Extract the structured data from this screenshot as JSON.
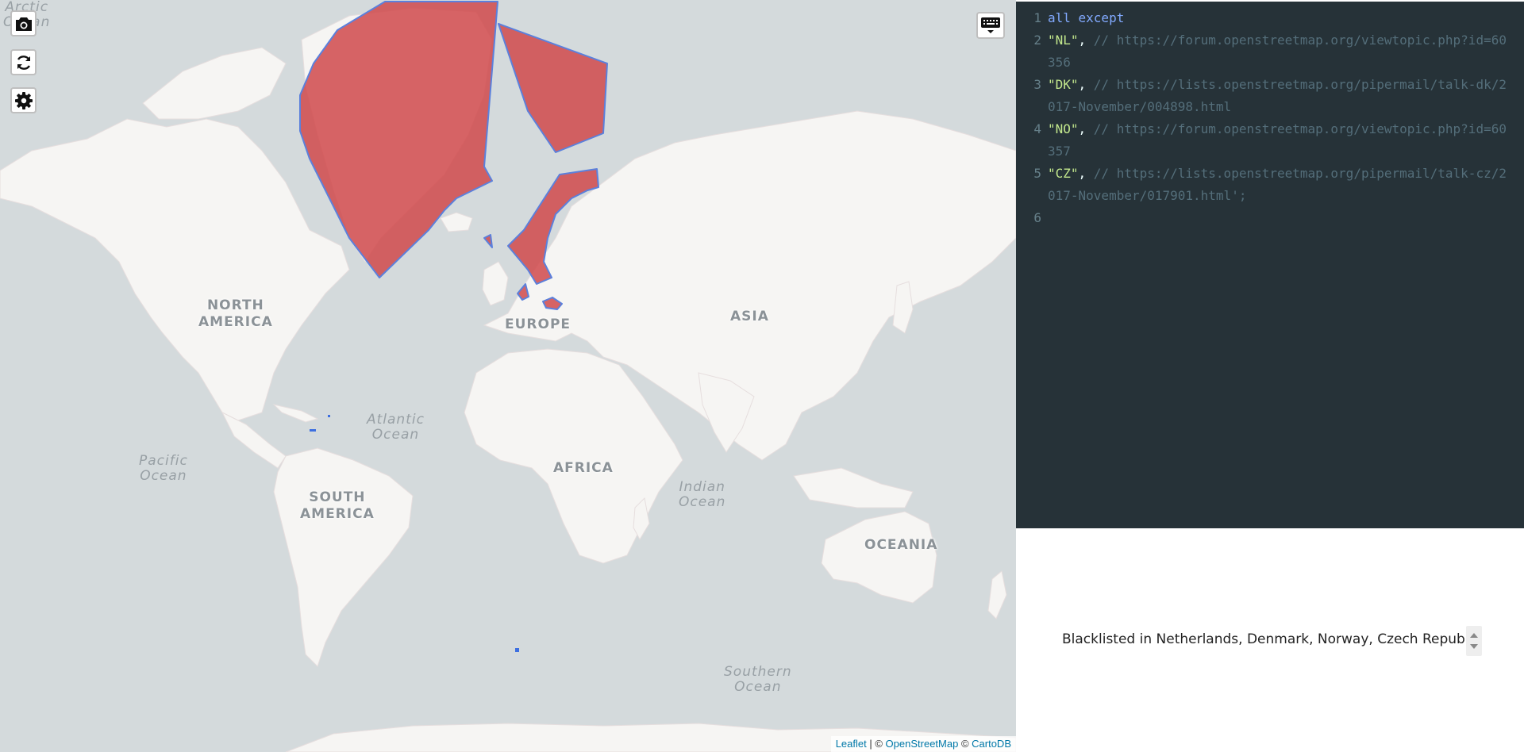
{
  "map": {
    "labels": {
      "north_america": "NORTH\nAMERICA",
      "south_america": "SOUTH\nAMERICA",
      "europe": "EUROPE",
      "asia": "ASIA",
      "africa": "AFRICA",
      "oceania": "OCEANIA"
    },
    "oceans": {
      "arctic": "Arctic\nOcean",
      "atlantic": "Atlantic\nOcean",
      "pacific": "Pacific\nOcean",
      "indian": "Indian\nOcean",
      "southern": "Southern\nOcean"
    },
    "highlighted_regions": [
      "Netherlands",
      "Denmark",
      "Norway",
      "Czech Republic"
    ],
    "region_color": "#d0494b",
    "region_stroke": "#5b80dc",
    "attribution": {
      "leaflet": "Leaflet",
      "sep1": " | © ",
      "osm": "OpenStreetMap",
      "sep2": " © ",
      "carto": "CartoDB"
    },
    "controls": {
      "screenshot": "camera-icon",
      "refresh": "refresh-icon",
      "settings": "gear-icon",
      "keyboard": "keyboard-icon"
    }
  },
  "editor": {
    "lines": [
      {
        "num": "1",
        "tokens": [
          {
            "t": "kw",
            "v": "all except"
          }
        ]
      },
      {
        "num": "2",
        "tokens": [
          {
            "t": "str",
            "v": "\"NL\""
          },
          {
            "t": "punct",
            "v": ", "
          },
          {
            "t": "cm",
            "v": "// https://forum.openstreetmap.org/viewtopic.php?id=60356"
          }
        ]
      },
      {
        "num": "3",
        "tokens": [
          {
            "t": "str",
            "v": "\"DK\""
          },
          {
            "t": "punct",
            "v": ", "
          },
          {
            "t": "cm",
            "v": "// https://lists.openstreetmap.org/pipermail/talk-dk/2017-November/004898.html"
          }
        ]
      },
      {
        "num": "4",
        "tokens": [
          {
            "t": "str",
            "v": "\"NO\""
          },
          {
            "t": "punct",
            "v": ", "
          },
          {
            "t": "cm",
            "v": "// https://forum.openstreetmap.org/viewtopic.php?id=60357"
          }
        ]
      },
      {
        "num": "5",
        "tokens": [
          {
            "t": "str",
            "v": "\"CZ\""
          },
          {
            "t": "punct",
            "v": ", "
          },
          {
            "t": "cm",
            "v": "// https://lists.openstreetmap.org/pipermail/talk-cz/2017-November/017901.html';"
          }
        ]
      },
      {
        "num": "6",
        "tokens": []
      }
    ]
  },
  "result": {
    "text": "Blacklisted in Netherlands, Denmark, Norway, Czech Republic"
  }
}
